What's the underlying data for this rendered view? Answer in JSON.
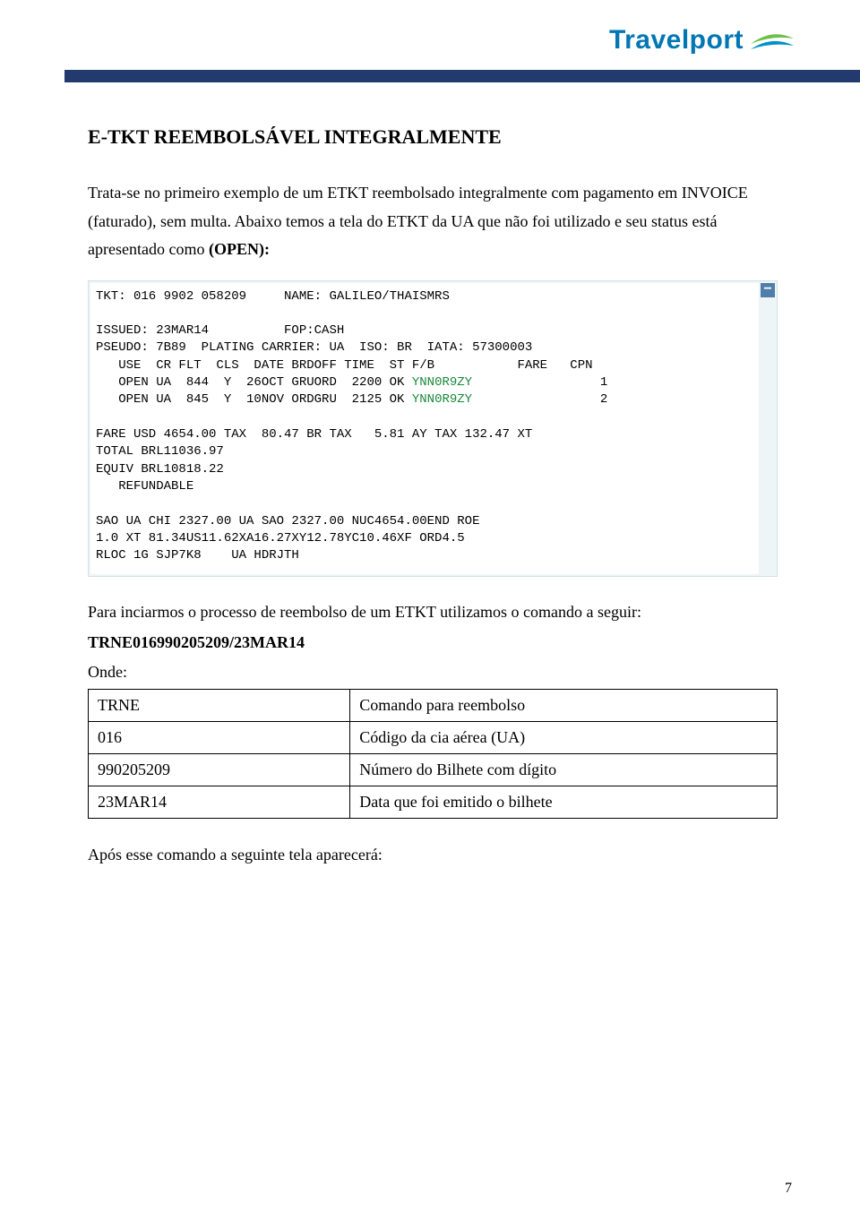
{
  "logo": {
    "text": "Travelport"
  },
  "heading": "E-TKT REEMBOLSÁVEL INTEGRALMENTE",
  "para1": "Trata-se no primeiro exemplo de um ETKT reembolsado integralmente com pagamento em INVOICE (faturado), sem multa. Abaixo temos a tela do ETKT da UA que não foi utilizado e seu status está apresentado como ",
  "para1_bold": "(OPEN):",
  "terminal": {
    "line01": "TKT: 016 9902 058209     NAME: GALILEO/THAISMRS",
    "line02": " ",
    "line03": "ISSUED: 23MAR14          FOP:CASH",
    "line04": "PSEUDO: 7B89  PLATING CARRIER: UA  ISO: BR  IATA: 57300003",
    "line05": "   USE  CR FLT  CLS  DATE BRDOFF TIME  ST F/B           FARE   CPN",
    "line06a": "   OPEN UA  844  Y  26OCT GRUORD  2200 OK ",
    "line06g": "YNN0R9ZY",
    "line06b": "                 1",
    "line07a": "   OPEN UA  845  Y  10NOV ORDGRU  2125 OK ",
    "line07g": "YNN0R9ZY",
    "line07b": "                 2",
    "line08": " ",
    "line09": "FARE USD 4654.00 TAX  80.47 BR TAX   5.81 AY TAX 132.47 XT",
    "line10": "TOTAL BRL11036.97",
    "line11": "EQUIV BRL10818.22",
    "line12": "   REFUNDABLE",
    "line13": " ",
    "line14": "SAO UA CHI 2327.00 UA SAO 2327.00 NUC4654.00END ROE",
    "line15": "1.0 XT 81.34US11.62XA16.27XY12.78YC10.46XF ORD4.5",
    "line16": "RLOC 1G SJP7K8    UA HDRJTH"
  },
  "para2": "Para inciarmos o processo de reembolso de um ETKT utilizamos o comando a seguir:",
  "command": "TRNE016990205209/23MAR14",
  "onde": "Onde:",
  "table": {
    "rows": [
      {
        "k": "TRNE",
        "v": "Comando para reembolso"
      },
      {
        "k": "016",
        "v": "Código da cia aérea (UA)"
      },
      {
        "k": "990205209",
        "v": "Número do Bilhete com dígito"
      },
      {
        "k": "23MAR14",
        "v": "Data que foi emitido o bilhete"
      }
    ]
  },
  "after": "Após esse comando a seguinte tela aparecerá:",
  "page": "7"
}
